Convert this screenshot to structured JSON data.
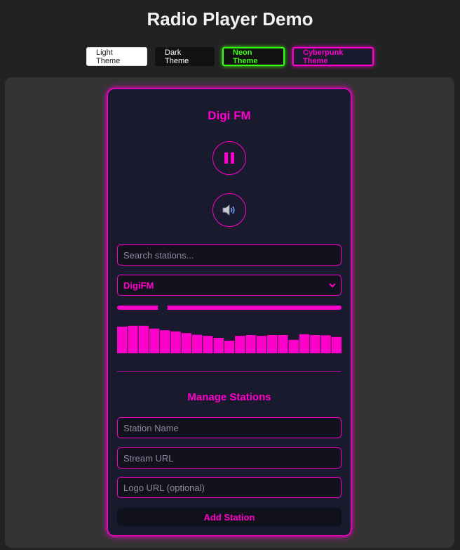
{
  "header": {
    "title": "Radio Player Demo"
  },
  "themes": {
    "light": "Light Theme",
    "dark": "Dark Theme",
    "neon": "Neon Theme",
    "cyberpunk": "Cyberpunk Theme"
  },
  "player": {
    "station_name": "Digi FM",
    "play_icon": "pause-icon",
    "volume_icon": "speaker-icon",
    "search_placeholder": "Search stations...",
    "selected_station": "DigiFM",
    "volume_level": 0.19,
    "visualizer_levels": [
      0.95,
      0.98,
      0.98,
      0.88,
      0.82,
      0.78,
      0.72,
      0.66,
      0.62,
      0.55,
      0.45,
      0.62,
      0.65,
      0.62,
      0.65,
      0.65,
      0.48,
      0.68,
      0.65,
      0.64,
      0.58
    ]
  },
  "manage": {
    "title": "Manage Stations",
    "name_placeholder": "Station Name",
    "url_placeholder": "Stream URL",
    "logo_placeholder": "Logo URL (optional)",
    "add_label": "Add Station"
  },
  "colors": {
    "accent": "#ff00cc",
    "neon": "#39ff14",
    "panel": "#1a1a2e",
    "page": "#222222"
  }
}
